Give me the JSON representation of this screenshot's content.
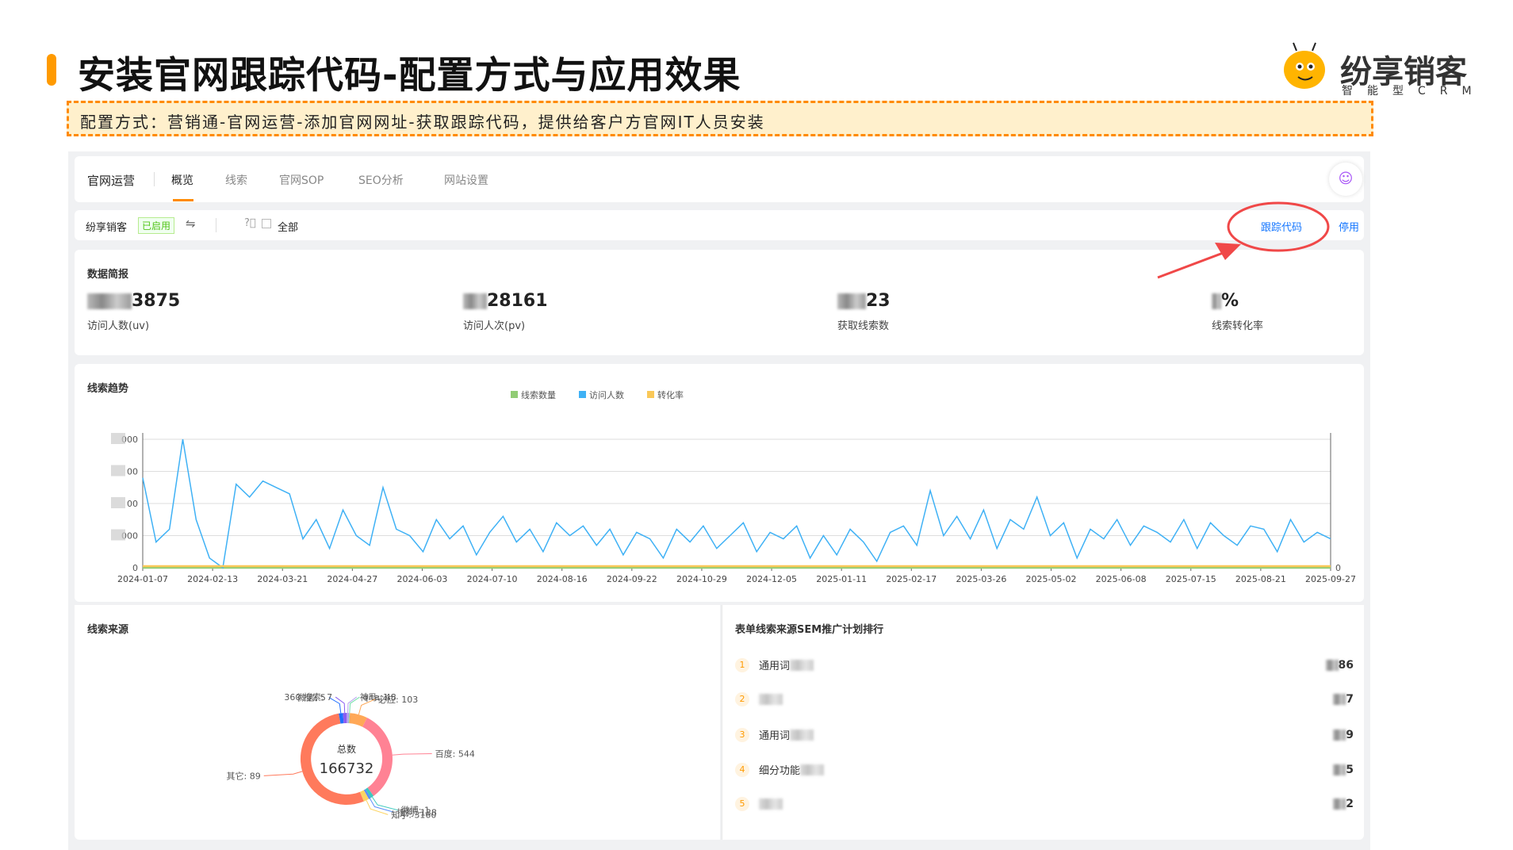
{
  "header": {
    "title": "安装官网跟踪代码-配置方式与应用效果",
    "note": "配置方式：营销通-官网运营-添加官网网址-获取跟踪代码，提供给客户方官网IT人员安装"
  },
  "logo": {
    "name": "纷享销客",
    "subtitle": "智能型CRM"
  },
  "nav": {
    "section": "官网运营",
    "tabs": [
      {
        "label": "概览",
        "active": true
      },
      {
        "label": "线索"
      },
      {
        "label": "官网SOP"
      },
      {
        "label": "SEO分析"
      },
      {
        "label": "网站设置"
      }
    ],
    "assistant_icon": "robot-icon"
  },
  "filter": {
    "site": "纷享销客",
    "status": "已启用",
    "switch_icon": "swap-icon",
    "help_icon": "question-icon",
    "date_icon": "calendar-icon",
    "range": "全部",
    "tracking_code": "跟踪代码",
    "disable": "停用"
  },
  "summary": {
    "title": "数据简报",
    "kpis": [
      {
        "value": "3875",
        "label": "访问人数(uv)"
      },
      {
        "value": "28161",
        "label": "访问人次(pv)"
      },
      {
        "value": "23",
        "label": "获取线索数"
      },
      {
        "value": "%",
        "label": "线索转化率"
      }
    ]
  },
  "colors": {
    "accent": "#ff9a00",
    "link": "#1677ff",
    "annotation": "#f04848",
    "status_green": "#52c41a"
  },
  "chart_data": [
    {
      "type": "line",
      "title": "线索趋势",
      "x_range": [
        "2024-01-07",
        "2025-09-27"
      ],
      "x_ticks": [
        "2024-01-07",
        "2024-02-13",
        "2024-03-21",
        "2024-04-27",
        "2024-06-03",
        "2024-07-10",
        "2024-08-16",
        "2024-09-22",
        "2024-10-29",
        "2024-12-05",
        "2025-01-11",
        "2025-02-17",
        "2025-03-26",
        "2025-05-02",
        "2025-06-08",
        "2025-07-15",
        "2025-08-21",
        "2025-09-27"
      ],
      "y_ticks_left": [
        "0",
        "000",
        "00",
        "00",
        "000"
      ],
      "y_ticks_right": [
        "0",
        "",
        "",
        "",
        "",
        ""
      ],
      "ylim": [
        0,
        4000
      ],
      "grid": true,
      "legend": "top-center",
      "series": [
        {
          "name": "线索数量",
          "color": "#91cc75",
          "values": [
            0,
            0
          ]
        },
        {
          "name": "访问人数",
          "color": "#3fb1f5",
          "values": [
            2800,
            800,
            1200,
            4000,
            1500,
            300,
            0,
            2600,
            2200,
            2700,
            2500,
            2300,
            900,
            1500,
            600,
            1800,
            1000,
            700,
            2500,
            1200,
            1000,
            500,
            1500,
            900,
            1300,
            400,
            1100,
            1600,
            800,
            1200,
            500,
            1400,
            1000,
            1300,
            700,
            1200,
            400,
            1100,
            900,
            300,
            1200,
            800,
            1300,
            600,
            1000,
            1400,
            500,
            1100,
            900,
            1300,
            300,
            1000,
            400,
            1200,
            800,
            200,
            1100,
            1300,
            700,
            2400,
            1000,
            1600,
            900,
            1800,
            600,
            1500,
            1200,
            2200,
            1000,
            1400,
            300,
            1200,
            900,
            1500,
            700,
            1300,
            1100,
            800,
            1500,
            600,
            1400,
            1000,
            700,
            1300,
            1200,
            500,
            1500,
            800,
            1100,
            900
          ]
        },
        {
          "name": "转化率",
          "color": "#fac858",
          "values": [
            0,
            0
          ]
        }
      ]
    },
    {
      "type": "pie",
      "title": "线索来源",
      "center_label": "总数",
      "total": "166732",
      "slices": [
        {
          "label": "神马: 1",
          "value": 1500,
          "color": "#b59cf0"
        },
        {
          "label": "qita: 48",
          "value": 480,
          "color": "#73e0a9"
        },
        {
          "label": "必应: 103",
          "value": 10300,
          "color": "#ffa857"
        },
        {
          "label": "百度: 544",
          "value": 54400,
          "color": "#ff8294"
        },
        {
          "label": "微博: 1",
          "value": 1900,
          "color": "#3cc9bd"
        },
        {
          "label": "搜狗: 138",
          "value": 1380,
          "color": "#5b8ff9"
        },
        {
          "label": "知乎: 3160",
          "value": 3160,
          "color": "#fcd462"
        },
        {
          "label": "其它: 89",
          "value": 89100,
          "color": "#ff7a5c"
        },
        {
          "label": "微信: 5",
          "value": 2400,
          "color": "#1f6fff"
        },
        {
          "label": "360 搜索: 7",
          "value": 2100,
          "color": "#8a5cf0"
        }
      ]
    }
  ],
  "ranking": {
    "title": "表单线索来源SEM推广计划排行",
    "items": [
      {
        "rank": "1",
        "name": "通用词",
        "value": "86"
      },
      {
        "rank": "2",
        "name": "",
        "value": "7"
      },
      {
        "rank": "3",
        "name": "通用词",
        "value": "9"
      },
      {
        "rank": "4",
        "name": "细分功能",
        "value": "5"
      },
      {
        "rank": "5",
        "name": "",
        "value": "2"
      }
    ]
  }
}
